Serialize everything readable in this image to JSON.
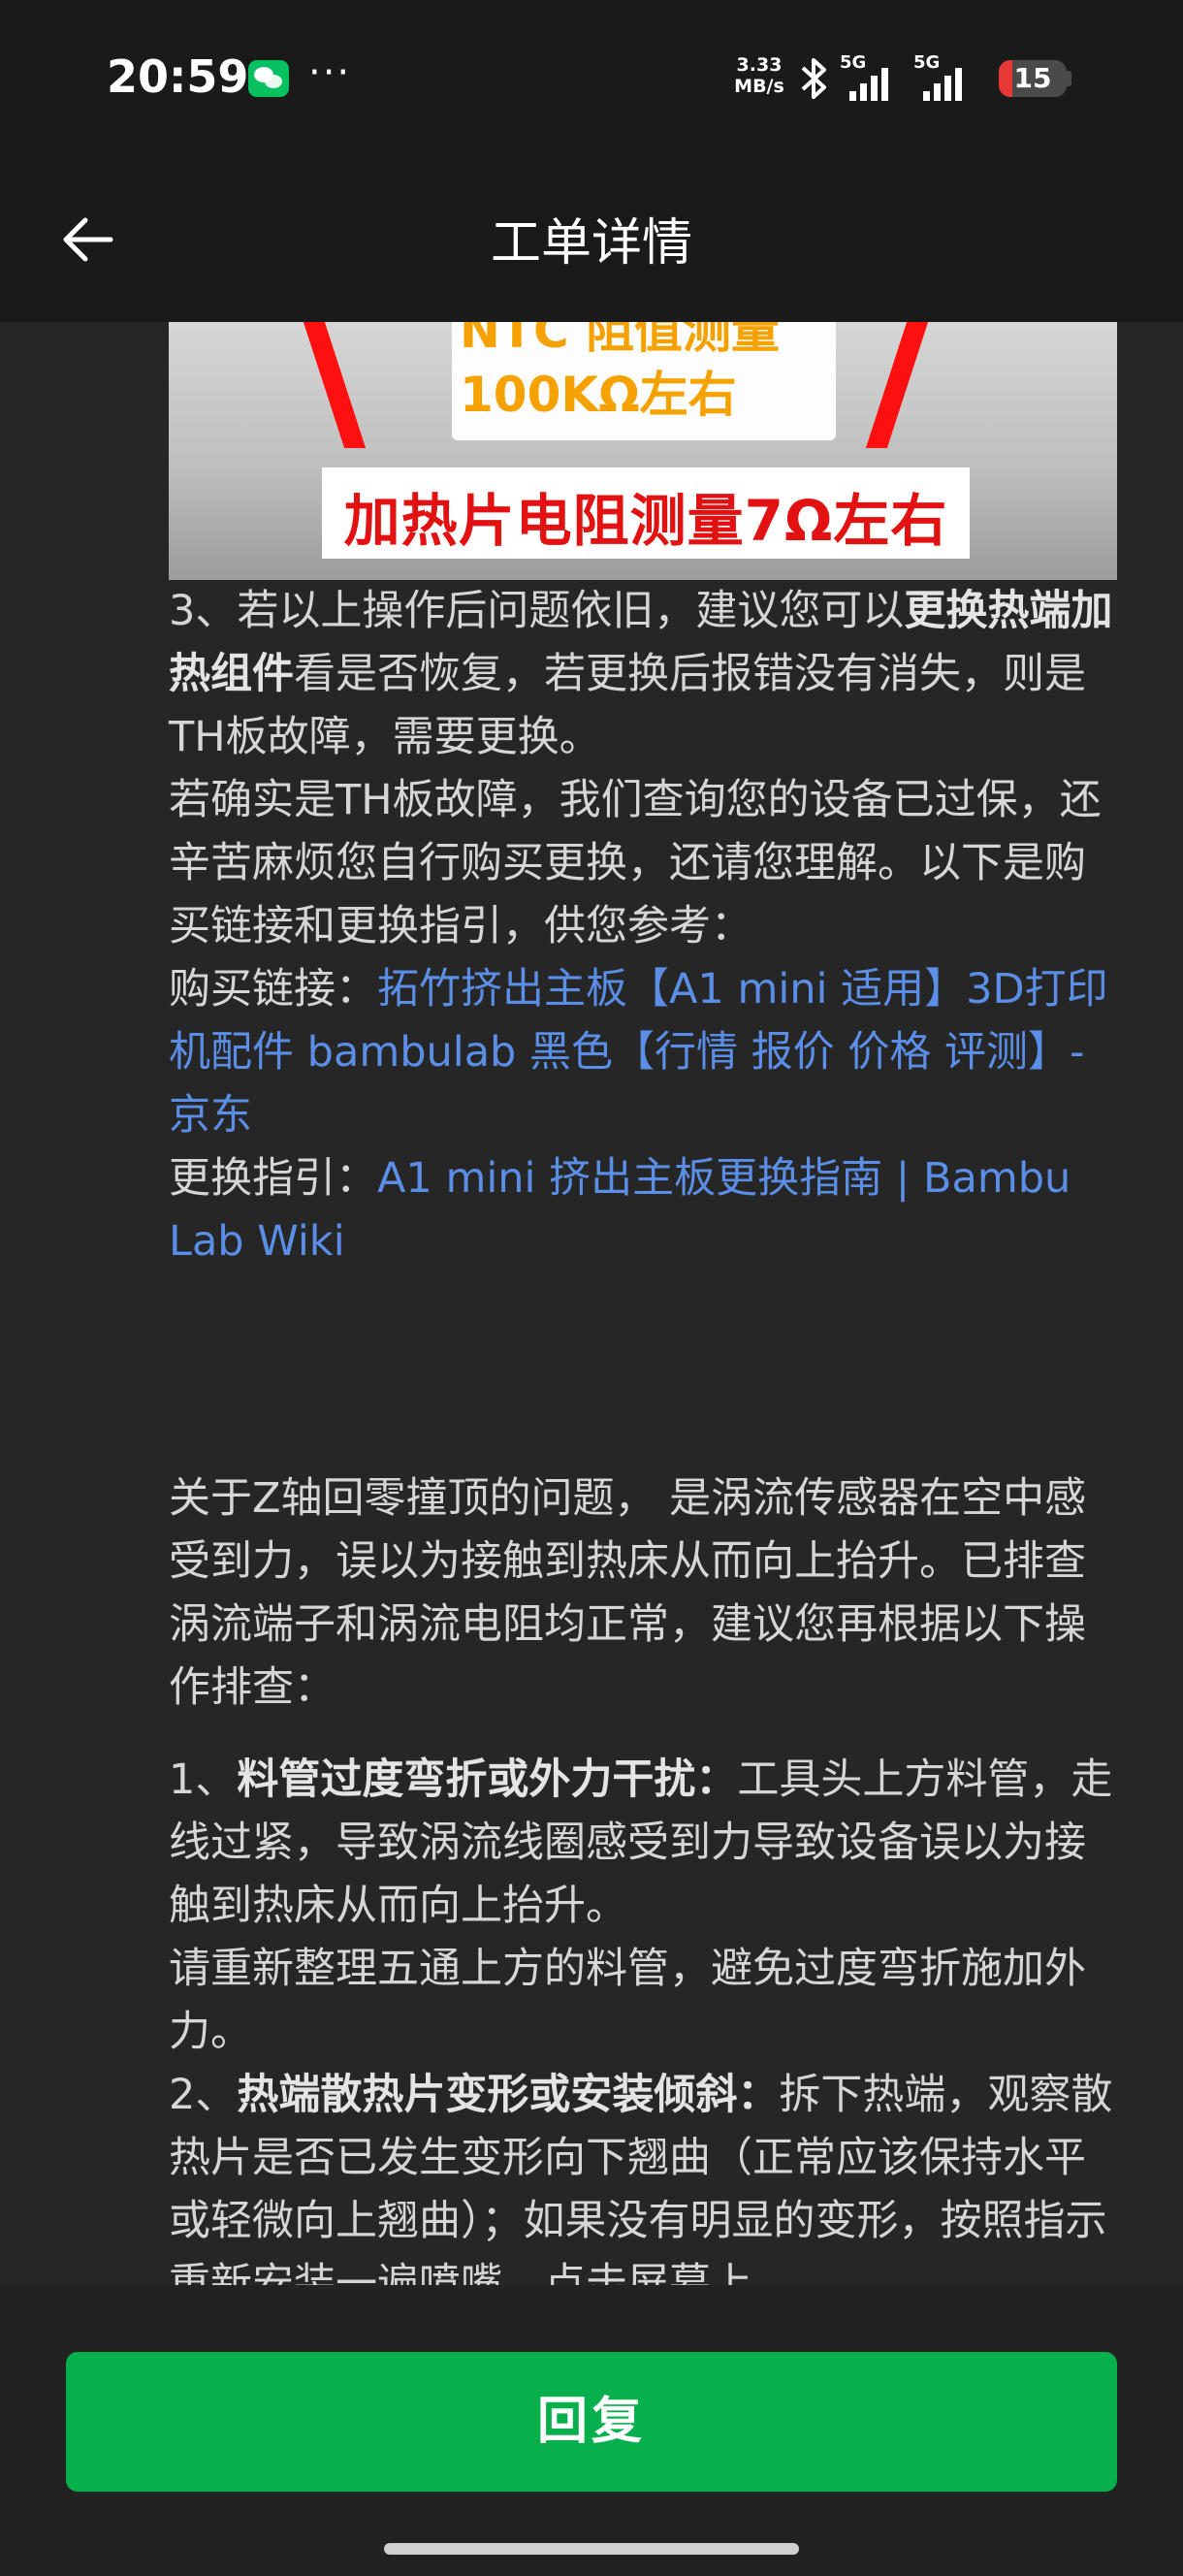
{
  "status_bar": {
    "time": "20:59",
    "more": "···",
    "net_speed_value": "3.33",
    "net_speed_unit": "MB/s",
    "signal_1": "5G",
    "signal_2": "5G",
    "battery": "15",
    "icons": [
      "wechat-icon",
      "bluetooth-icon",
      "signal-icon",
      "battery-icon"
    ]
  },
  "nav": {
    "title": "工单详情",
    "back_icon": "arrow-left-icon"
  },
  "image": {
    "caption_top_line1": "NTC 阻值测量",
    "caption_top_line2": "100KΩ左右",
    "caption_bottom": "加热片电阻测量7Ω左右"
  },
  "content": {
    "p1_a": "3、若以上操作后问题依旧，建议您可以",
    "p1_b": "更换热端加热组件",
    "p1_c": "看是否恢复，若更换后报错没有消失，则是TH板故障，需要更换。",
    "p2": "若确实是TH板故障，我们查询您的设备已过保，还辛苦麻烦您自行购买更换，还请您理解。以下是购买链接和更换指引，供您参考：",
    "buy_label": "购买链接：",
    "buy_link": "拓竹挤出主板【A1 mini 适用】3D打印机配件 bambulab 黑色【行情 报价 价格 评测】-京东",
    "guide_label": "更换指引：",
    "guide_link": "A1 mini 挤出主板更换指南 | Bambu Lab Wiki",
    "p3": "关于Z轴回零撞顶的问题， 是涡流传感器在空中感受到力，误以为接触到热床从而向上抬升。已排查涡流端子和涡流电阻均正常，建议您再根据以下操作排查：",
    "s1_num": "1、",
    "s1_title": "料管过度弯折或外力干扰：",
    "s1_text": "工具头上方料管，走线过紧，导致涡流线圈感受到力导致设备误以为接触到热床从而向上抬升。",
    "s1_text2": "请重新整理五通上方的料管，避免过度弯折施加外力。",
    "s2_num": "2、",
    "s2_title": "热端散热片变形或安装倾斜：",
    "s2_text": "拆下热端，观察散热片是否已发生变形向下翘曲（正常应该保持水平或轻微向上翘曲）；如果没有明显的变形，按照指示重新安装一遍喷嘴，点击屏幕上"
  },
  "footer": {
    "reply_label": "回复"
  },
  "colors": {
    "background": "#262626",
    "link": "#5b8ee6",
    "reply_button": "#07b04c"
  }
}
